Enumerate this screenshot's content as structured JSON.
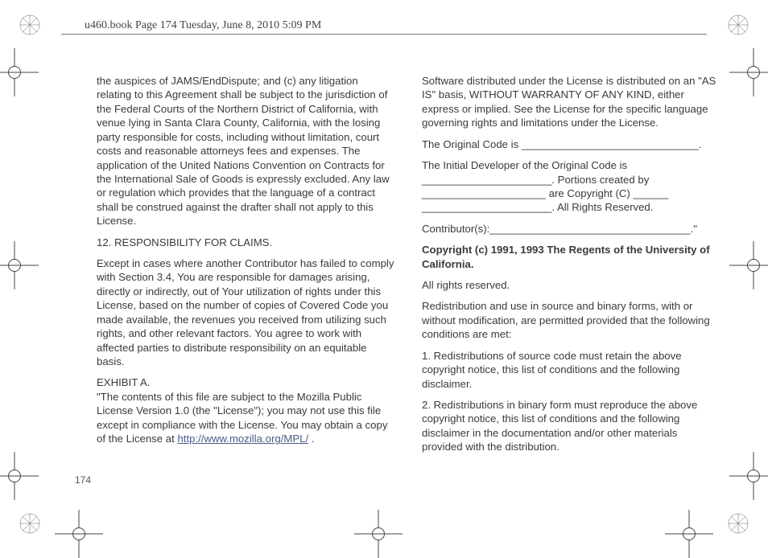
{
  "header": "u460.book  Page 174  Tuesday, June 8, 2010  5:09 PM",
  "page_number": "174",
  "left_col": {
    "p1": "the auspices of JAMS/EndDispute; and (c) any litigation relating to this Agreement shall be subject to the jurisdiction of the Federal Courts of the Northern District of California, with venue lying in Santa Clara County, California, with the losing party responsible for costs, including without limitation, court costs and reasonable attorneys fees and expenses. The application of the United Nations Convention on Contracts for the International Sale of Goods is expressly excluded. Any law or regulation which provides that the language of a contract shall be construed against the drafter shall not apply to this License.",
    "h1": "12. RESPONSIBILITY FOR CLAIMS.",
    "p2": "Except in cases where another Contributor has failed to comply with Section 3.4, You are responsible for damages arising, directly or indirectly, out of Your utilization of rights under this License, based on the number of copies of Covered Code you made available, the revenues you received from utilizing such rights, and other relevant factors. You agree to work with affected parties to distribute responsibility on an equitable basis.",
    "h2a": "EXHIBIT A.",
    "p3a": "\"The contents of this file are subject to the Mozilla Public License Version 1.0 (the \"License\"); you may not use this file except in compliance with the License. You may obtain a copy of the License at ",
    "link": "http://www.mozilla.org/MPL/",
    "p3b": " ."
  },
  "right_col": {
    "p1": "Software distributed under the License is distributed on an \"AS IS\" basis, WITHOUT WARRANTY OF ANY KIND, either express or implied. See the License for the specific language governing rights and limitations under the License.",
    "p2": "The Original Code is ______________________________.",
    "p3": "The Initial Developer of the Original Code is ______________________. Portions created by _____________________ are Copyright (C) ______ ______________________. All Rights Reserved.",
    "p4": "Contributor(s):__________________________________.\"",
    "h1": "Copyright (c) 1991, 1993 The Regents of the University of California.",
    "p5": "All rights reserved.",
    "p6": "Redistribution and use in source and binary forms, with or without modification, are permitted provided that the following conditions are met:",
    "p7": "1. Redistributions of source code must retain the above copyright notice, this list of conditions and the following disclaimer.",
    "p8": "2. Redistributions in binary form must reproduce the above copyright notice, this list of conditions and the following disclaimer in the documentation and/or other materials provided with the distribution."
  }
}
